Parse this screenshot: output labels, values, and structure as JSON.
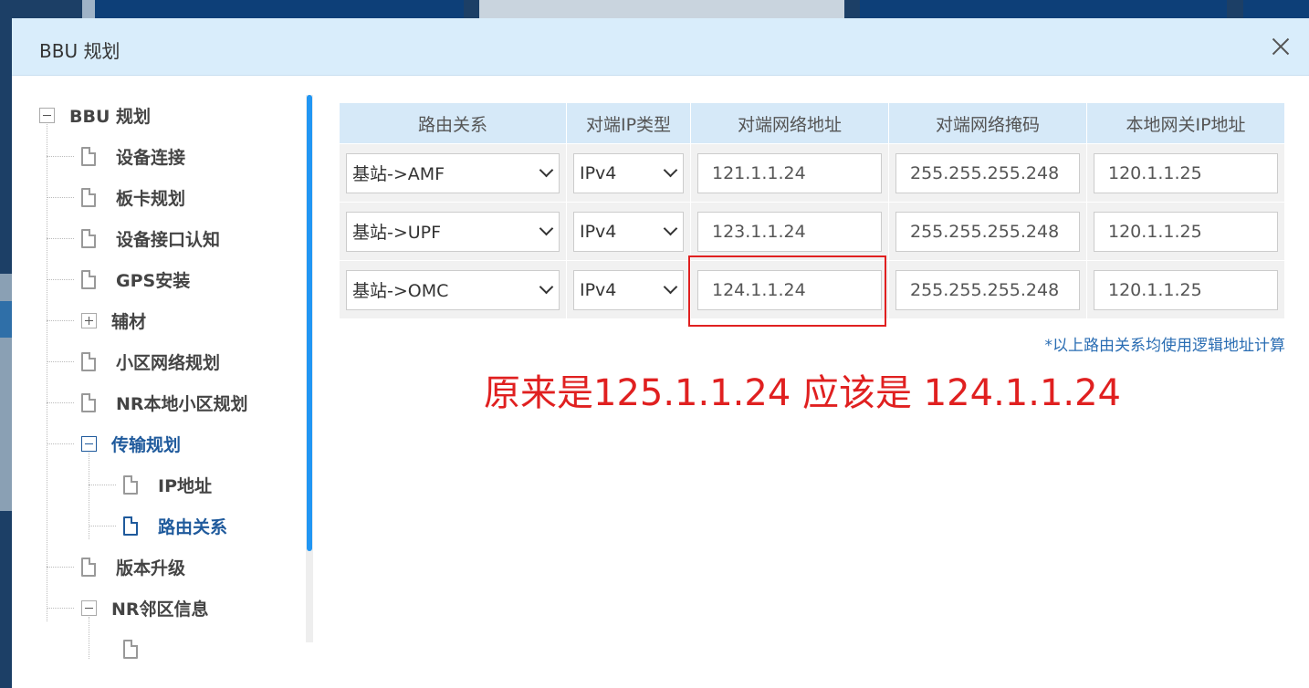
{
  "dialog": {
    "title": "BBU 规划"
  },
  "tree": {
    "root": "BBU 规划",
    "items": [
      "设备连接",
      "板卡规划",
      "设备接口认知",
      "GPS安装",
      "辅材",
      "小区网络规划",
      "NR本地小区规划",
      "传输规划",
      "IP地址",
      "路由关系",
      "版本升级",
      "NR邻区信息"
    ]
  },
  "table": {
    "headers": [
      "路由关系",
      "对端IP类型",
      "对端网络地址",
      "对端网络掩码",
      "本地网关IP地址"
    ],
    "rows": [
      {
        "relation": "基站->AMF",
        "ip_type": "IPv4",
        "peer_address": "121.1.1.24",
        "peer_mask": "255.255.255.248",
        "gateway": "120.1.1.25"
      },
      {
        "relation": "基站->UPF",
        "ip_type": "IPv4",
        "peer_address": "123.1.1.24",
        "peer_mask": "255.255.255.248",
        "gateway": "120.1.1.25"
      },
      {
        "relation": "基站->OMC",
        "ip_type": "IPv4",
        "peer_address": "124.1.1.24",
        "peer_mask": "255.255.255.248",
        "gateway": "120.1.1.25"
      }
    ]
  },
  "note": "*以上路由关系均使用逻辑地址计算",
  "annotation": "原来是125.1.1.24 应该是 124.1.1.24",
  "colors": {
    "accent": "#1f5a9c",
    "header_bg": "#d9edfb",
    "annotation": "#e02020"
  }
}
